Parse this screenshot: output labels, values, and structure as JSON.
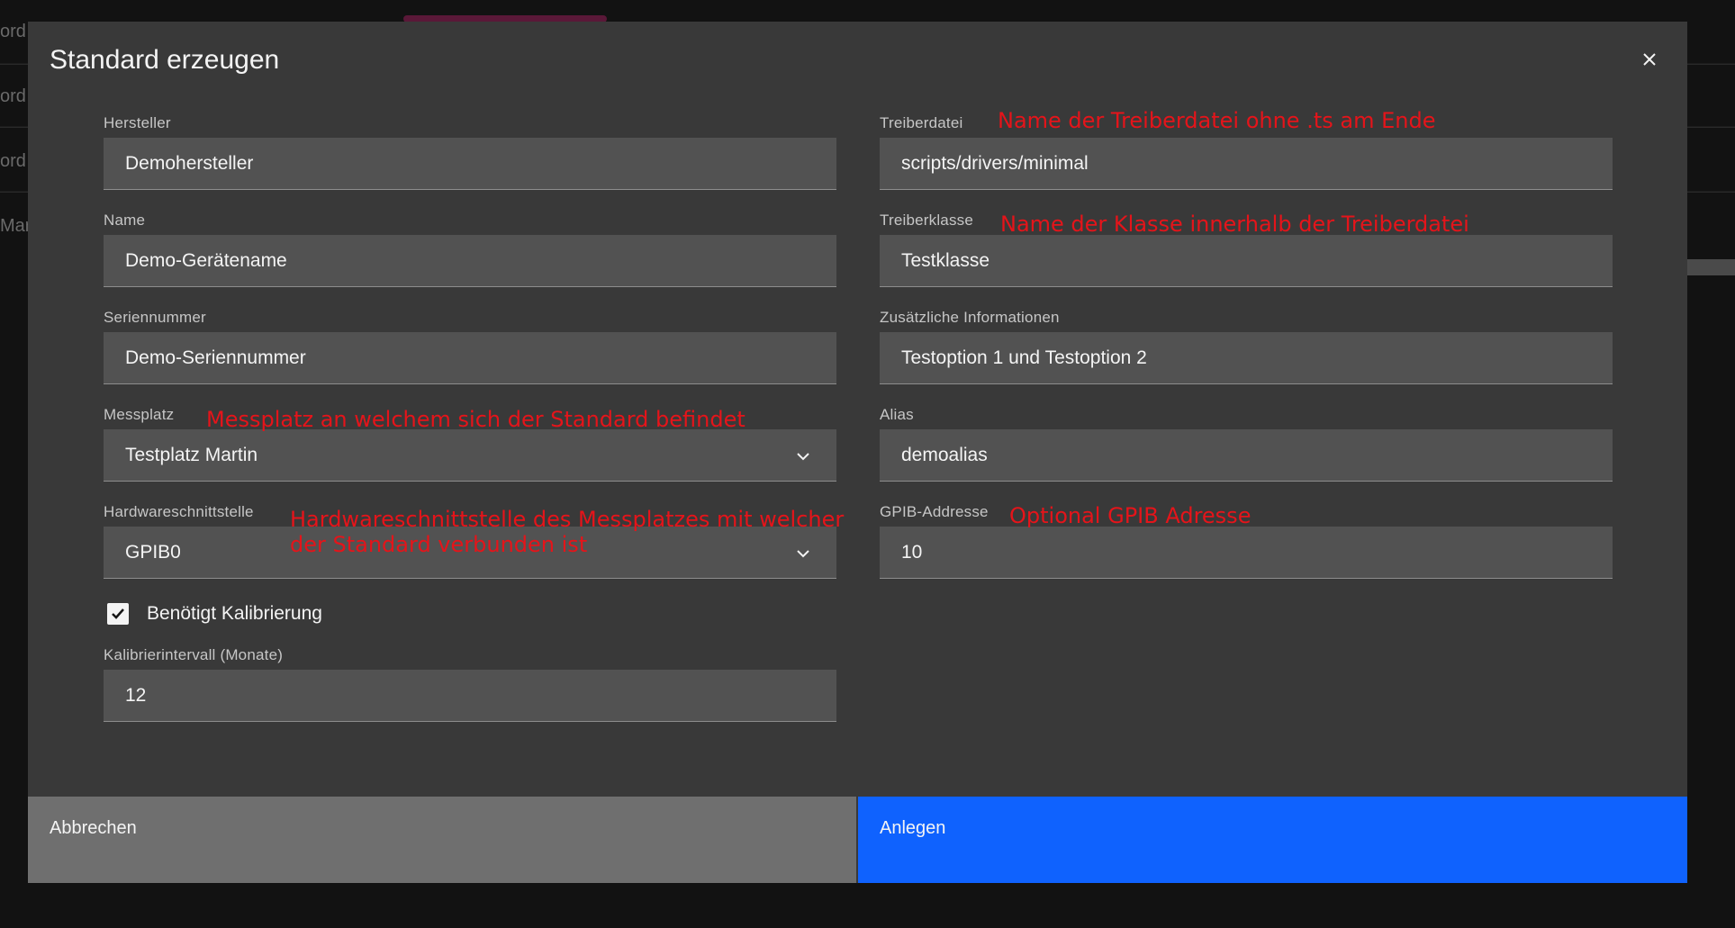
{
  "background": {
    "row_fragments": [
      "ord",
      "ord",
      "ord",
      "Mart"
    ]
  },
  "modal": {
    "title": "Standard erzeugen",
    "close_icon": "close-icon",
    "fields": {
      "hersteller": {
        "label": "Hersteller",
        "value": "Demohersteller"
      },
      "name": {
        "label": "Name",
        "value": "Demo-Gerätename"
      },
      "seriennummer": {
        "label": "Seriennummer",
        "value": "Demo-Seriennummer"
      },
      "messplatz": {
        "label": "Messplatz",
        "value": "Testplatz Martin"
      },
      "hardwareschnittstelle": {
        "label": "Hardwareschnittstelle",
        "value": "GPIB0"
      },
      "kalibrierintervall": {
        "label": "Kalibrierintervall (Monate)",
        "value": "12"
      },
      "treiberdatei": {
        "label": "Treiberdatei",
        "value": "scripts/drivers/minimal"
      },
      "treiberklasse": {
        "label": "Treiberklasse",
        "value": "Testklasse"
      },
      "zusatz": {
        "label": "Zusätzliche Informationen",
        "value": "Testoption 1 und Testoption 2"
      },
      "alias": {
        "label": "Alias",
        "value": "demoalias"
      },
      "gpib": {
        "label": "GPIB-Addresse",
        "value": "10"
      }
    },
    "checkbox": {
      "label": "Benötigt Kalibrierung",
      "checked": true
    },
    "annotations": {
      "treiberdatei": "Name der Treiberdatei ohne .ts am Ende",
      "treiberklasse": "Name der Klasse innerhalb der Treiberdatei",
      "messplatz": "Messplatz an welchem sich der Standard befindet",
      "hardwareschnittstelle_line1": "Hardwareschnittstelle des Messplatzes mit welcher",
      "hardwareschnittstelle_line2": "der Standard verbunden ist",
      "gpib": "Optional GPIB Adresse"
    },
    "buttons": {
      "cancel": "Abbrechen",
      "submit": "Anlegen"
    }
  },
  "colors": {
    "modal_bg": "#393939",
    "field_bg": "#525252",
    "primary": "#0f62fe",
    "secondary": "#6f6f6f",
    "annotation": "#e5141a"
  }
}
